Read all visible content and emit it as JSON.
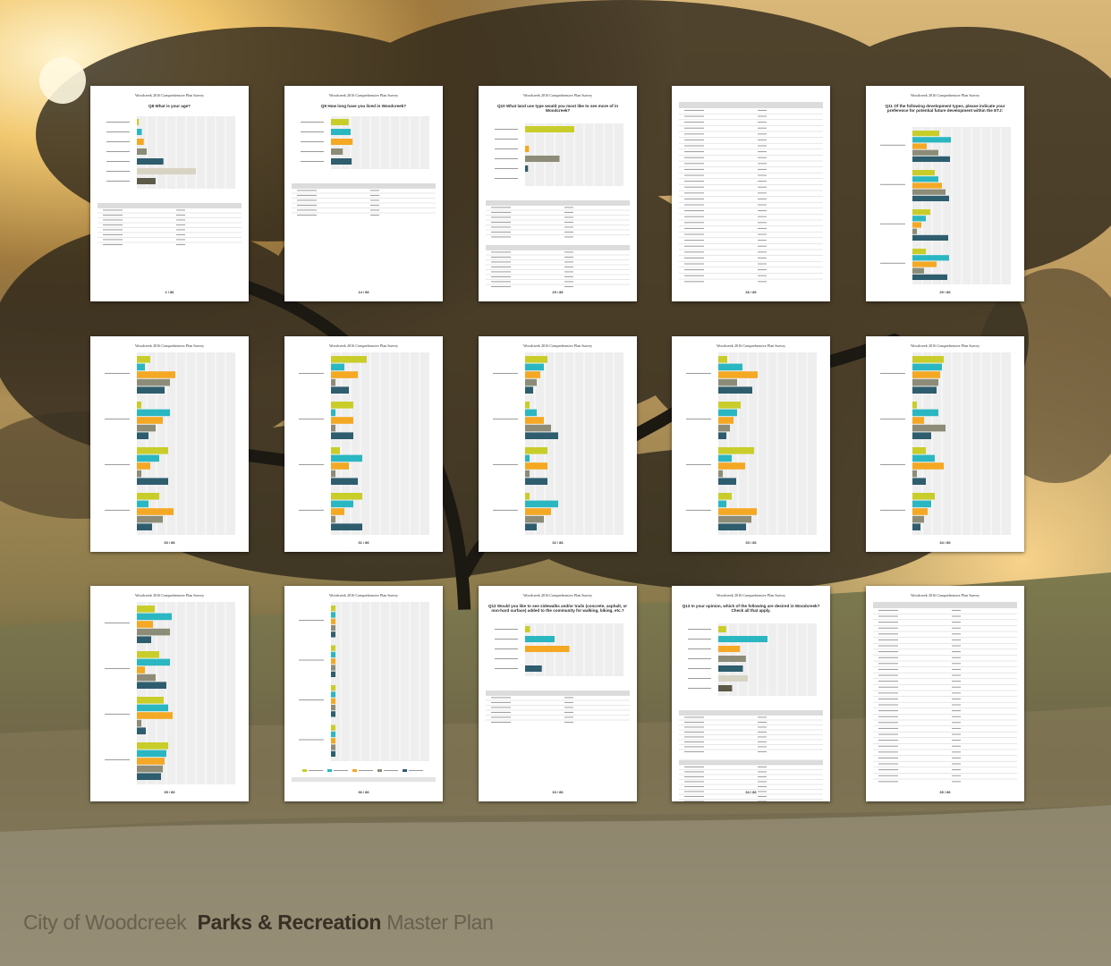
{
  "background": {
    "sky": "#f3d9a0",
    "ground": "#6e6848",
    "sun": "#fff6d8",
    "trees": "#24201a"
  },
  "brand": {
    "city": "City of Woodcreek",
    "bold": "Parks & Recreation",
    "rest": "Master Plan"
  },
  "colors": {
    "olive": "#c9cd2a",
    "teal": "#2bb7c1",
    "orange": "#f4a824",
    "gray": "#8c8c78",
    "navy": "#2e5d6e",
    "beige": "#d8d4c4",
    "dark": "#5c5a48"
  },
  "pages": [
    {
      "header": "Woodcreek 2016 Comprehensive Plan Survey",
      "question": "Q8 What is your age?",
      "page_num": "2 / 86",
      "type": "bar-table",
      "bars": [
        2,
        5,
        7,
        10,
        27,
        60,
        19
      ]
    },
    {
      "header": "Woodcreek 2016 Comprehensive Plan Survey",
      "question": "Q9 How long have you lived in Woodcreek?",
      "page_num": "14 / 86",
      "type": "bar-table",
      "bars": [
        18,
        20,
        22,
        12,
        21
      ]
    },
    {
      "header": "Woodcreek 2016 Comprehensive Plan Survey",
      "question": "Q10 What land use type would you most like to see more of in Woodcreek?",
      "page_num": "25 / 86",
      "type": "bar-table-list",
      "bars": [
        50,
        0,
        4,
        35,
        3,
        0
      ]
    },
    {
      "header": "",
      "question": "",
      "page_num": "26 / 86",
      "type": "list"
    },
    {
      "header": "Woodcreek 2016 Comprehensive Plan Survey",
      "question": "Q11 Of the following development types, please indicate your preference for potential future development within the ETJ:",
      "page_num": "29 / 86",
      "type": "grouped"
    },
    {
      "header": "Woodcreek 2016 Comprehensive Plan Survey",
      "question": "",
      "page_num": "30 / 86",
      "type": "grouped-full"
    },
    {
      "header": "Woodcreek 2016 Comprehensive Plan Survey",
      "question": "",
      "page_num": "31 / 86",
      "type": "grouped-full"
    },
    {
      "header": "Woodcreek 2016 Comprehensive Plan Survey",
      "question": "",
      "page_num": "32 / 86",
      "type": "grouped-full"
    },
    {
      "header": "Woodcreek 2016 Comprehensive Plan Survey",
      "question": "",
      "page_num": "33 / 86",
      "type": "grouped-full"
    },
    {
      "header": "Woodcreek 2016 Comprehensive Plan Survey",
      "question": "",
      "page_num": "34 / 86",
      "type": "grouped-full"
    },
    {
      "header": "Woodcreek 2016 Comprehensive Plan Survey",
      "question": "",
      "page_num": "35 / 86",
      "type": "grouped-full"
    },
    {
      "header": "Woodcreek 2016 Comprehensive Plan Survey",
      "question": "",
      "page_num": "36 / 86",
      "type": "grouped-legend"
    },
    {
      "header": "Woodcreek 2016 Comprehensive Plan Survey",
      "question": "Q12 Would you like to see sidewalks and/or trails (concrete, asphalt, or non-hard surface) added to the community for walking, biking, etc.?",
      "page_num": "33 / 86",
      "type": "bar-table",
      "bars": [
        5,
        30,
        45,
        0,
        17
      ]
    },
    {
      "header": "Woodcreek 2016 Comprehensive Plan Survey",
      "question": "Q13 In your opinion, which of the following are desired in Woodcreek? Check all that apply.",
      "page_num": "34 / 86",
      "type": "bar-table-list",
      "bars": [
        8,
        50,
        22,
        28,
        25,
        30,
        14
      ]
    },
    {
      "header": "Woodcreek 2016 Comprehensive Plan Survey",
      "question": "",
      "page_num": "35 / 86",
      "type": "list"
    }
  ]
}
